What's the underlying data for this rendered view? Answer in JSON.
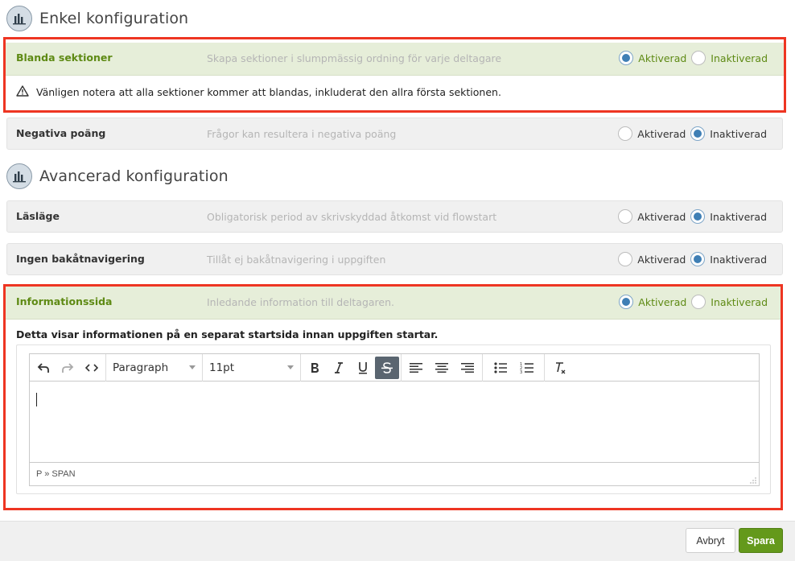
{
  "colors": {
    "accent_green": "#5e8a14",
    "active_row_bg": "#e6eed9",
    "highlight_red": "#ee3522",
    "save_button": "#64991b",
    "radio_selected": "#3f7fb5"
  },
  "simple_section": {
    "title": "Enkel konfiguration",
    "icon": "chart-icon"
  },
  "advanced_section": {
    "title": "Avancerad konfiguration",
    "icon": "chart-icon"
  },
  "radio_labels": {
    "on": "Aktiverad",
    "off": "Inaktiverad"
  },
  "settings": {
    "shuffle": {
      "label": "Blanda sektioner",
      "description": "Skapa sektioner i slumpmässig ordning för varje deltagare",
      "selected": "Aktiverad",
      "note": "Vänligen notera att alla sektioner kommer att blandas, inkluderat den allra första sektionen.",
      "note_icon": "warning-icon"
    },
    "negative": {
      "label": "Negativa poäng",
      "description": "Frågor kan resultera i negativa poäng",
      "selected": "Inaktiverad"
    },
    "read_mode": {
      "label": "Läsläge",
      "description": "Obligatorisk period av skrivskyddad åtkomst vid flowstart",
      "selected": "Inaktiverad"
    },
    "no_back": {
      "label": "Ingen bakåtnavigering",
      "description": "Tillåt ej bakåtnavigering i uppgiften",
      "selected": "Inaktiverad"
    },
    "info_page": {
      "label": "Informationssida",
      "description": "Inledande information till deltagaren.",
      "selected": "Aktiverad",
      "explanation": "Detta visar informationen på en separat startsida innan uppgiften startar."
    }
  },
  "editor": {
    "format_select": "Paragraph",
    "size_select": "11pt",
    "status_path": "P » SPAN",
    "tools": [
      "undo-icon",
      "redo-icon",
      "code-icon",
      "bold-icon",
      "italic-icon",
      "underline-icon",
      "strikethrough-icon",
      "align-left-icon",
      "align-center-icon",
      "align-right-icon",
      "bullet-list-icon",
      "numbered-list-icon",
      "clear-format-icon"
    ],
    "pressed_tool": "strikethrough-icon"
  },
  "footer": {
    "cancel_label": "Avbryt",
    "save_label": "Spara"
  }
}
